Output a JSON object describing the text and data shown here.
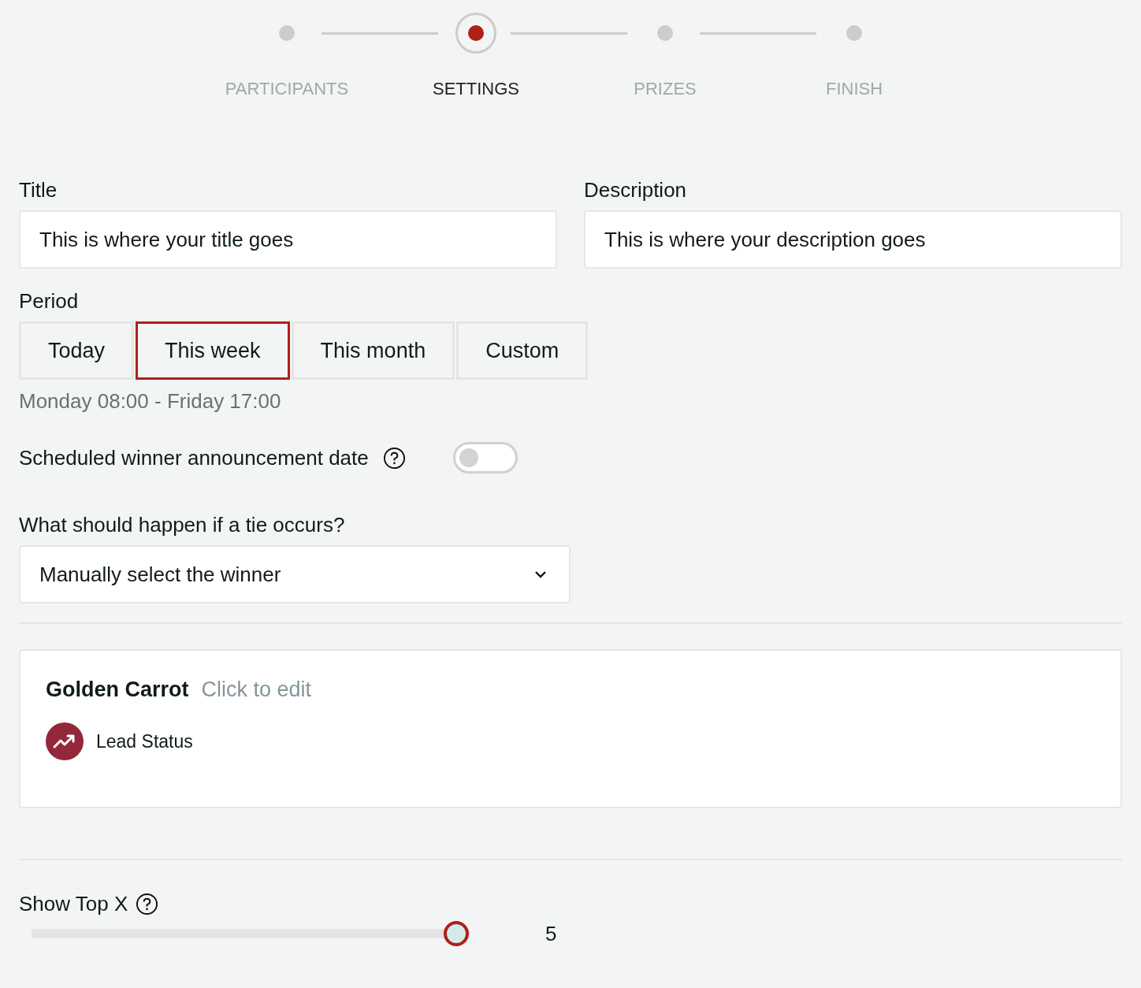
{
  "stepper": [
    {
      "label": "PARTICIPANTS",
      "selected": false
    },
    {
      "label": "SETTINGS",
      "selected": true
    },
    {
      "label": "PRIZES",
      "selected": false
    },
    {
      "label": "FINISH",
      "selected": false
    }
  ],
  "title_field": {
    "label": "Title",
    "value": "This is where your title goes"
  },
  "description_field": {
    "label": "Description",
    "value": "This is where your description goes"
  },
  "period": {
    "label": "Period",
    "options": [
      {
        "label": "Today",
        "selected": false
      },
      {
        "label": "This week",
        "selected": true
      },
      {
        "label": "This month",
        "selected": false
      },
      {
        "label": "Custom",
        "selected": false
      }
    ],
    "range": "Monday 08:00 - Friday 17:00"
  },
  "scheduled_announcement": {
    "label": "Scheduled winner announcement date",
    "on": false
  },
  "tie": {
    "label": "What should happen if a tie occurs?",
    "value": "Manually select the winner"
  },
  "card": {
    "title": "Golden Carrot",
    "action": "Click to edit",
    "metric": "Lead Status"
  },
  "show_top": {
    "label": "Show Top X",
    "level": 0.97,
    "reading": "5"
  }
}
